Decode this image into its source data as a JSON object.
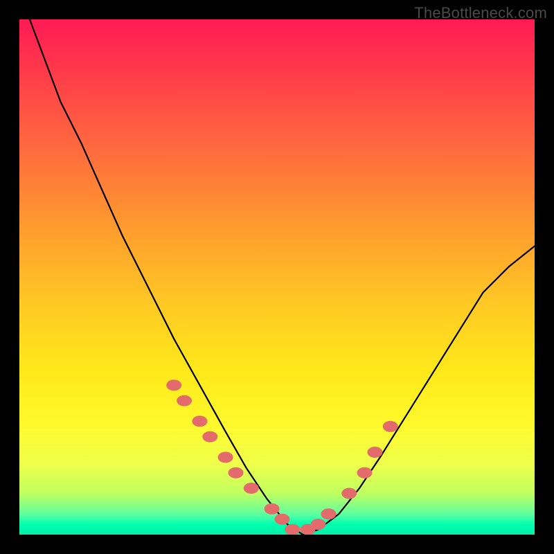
{
  "watermark": "TheBottleneck.com",
  "chart_data": {
    "type": "line",
    "title": "",
    "xlabel": "",
    "ylabel": "",
    "xlim": [
      0,
      100
    ],
    "ylim": [
      0,
      100
    ],
    "note": "V-shaped bottleneck curve over a vertical red-to-green gradient. Minimum (0% bottleneck) around x≈55. Pink/salmon dot markers cluster near the valley on both flanks.",
    "series": [
      {
        "name": "bottleneck-curve",
        "x": [
          0,
          2,
          5,
          8,
          12,
          16,
          20,
          25,
          30,
          35,
          40,
          44,
          48,
          52,
          55,
          58,
          62,
          66,
          70,
          75,
          80,
          85,
          90,
          95,
          100
        ],
        "y": [
          105,
          100,
          92,
          84,
          76,
          67,
          58,
          48,
          38,
          29,
          20,
          13,
          7,
          2,
          0,
          1,
          4,
          9,
          15,
          23,
          31,
          39,
          47,
          52,
          56
        ]
      }
    ],
    "markers": {
      "name": "sample-points",
      "color": "#e36b6b",
      "x": [
        30,
        32,
        35,
        37,
        40,
        42,
        45,
        49,
        51,
        53,
        56,
        58,
        60,
        64,
        67,
        69,
        72
      ],
      "y": [
        29,
        26,
        22,
        19,
        15,
        12,
        9,
        5,
        3,
        1,
        1,
        2,
        4,
        8,
        12,
        16,
        21
      ]
    }
  }
}
